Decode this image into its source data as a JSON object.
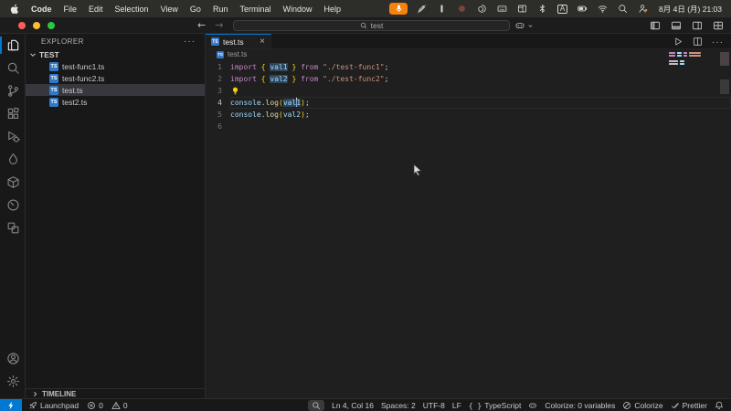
{
  "colors": {
    "accent": "#0078d4",
    "keyword": "#c586c0",
    "variable": "#9cdcfe",
    "string": "#ce9178",
    "function": "#dcdcaa",
    "bracket": "#ffd700",
    "mic_badge": "#f4820c",
    "ts_badge": "#3178c6"
  },
  "menubar": {
    "app_items": [
      "Code",
      "File",
      "Edit",
      "Selection",
      "View",
      "Go",
      "Run",
      "Terminal",
      "Window",
      "Help"
    ],
    "status_icons": [
      "mic-icon",
      "pencil-slash-icon",
      "capsule-icon",
      "record-dot-icon",
      "swirl-icon",
      "keyboard-icon",
      "window-tiles-icon",
      "bluetooth-icon",
      "input-source-icon",
      "battery-icon",
      "wifi-icon",
      "search-icon",
      "user-switch-icon"
    ],
    "input_source_label": "A",
    "clock": "8月 4日 (月) 21:03"
  },
  "titlebar": {
    "search_value": "test",
    "window_controls": [
      "layout-sidebar-left-icon",
      "layout-panel-icon",
      "layout-sidebar-right-icon",
      "customize-layout-icon"
    ]
  },
  "activity_bar": {
    "items": [
      {
        "name": "explorer-icon",
        "active": true
      },
      {
        "name": "search-icon",
        "active": false
      },
      {
        "name": "source-control-icon",
        "active": false
      },
      {
        "name": "extensions-icon",
        "active": false
      },
      {
        "name": "run-debug-icon",
        "active": false
      },
      {
        "name": "droplet-icon",
        "active": false
      },
      {
        "name": "cube-icon",
        "active": false
      },
      {
        "name": "clock-icon",
        "active": false
      },
      {
        "name": "layers-icon",
        "active": false
      }
    ],
    "bottom_items": [
      {
        "name": "account-icon"
      },
      {
        "name": "settings-gear-icon"
      }
    ]
  },
  "sidebar": {
    "title": "EXPLORER",
    "actions_label": "···",
    "folder": {
      "name": "TEST"
    },
    "files": [
      {
        "label": "test-func1.ts",
        "badge": "TS",
        "selected": false
      },
      {
        "label": "test-func2.ts",
        "badge": "TS",
        "selected": false
      },
      {
        "label": "test.ts",
        "badge": "TS",
        "selected": true
      },
      {
        "label": "test2.ts",
        "badge": "TS",
        "selected": false
      }
    ],
    "timeline_label": "TIMELINE"
  },
  "editor": {
    "tab": {
      "label": "test.ts",
      "badge": "TS"
    },
    "tab_actions": [
      "run-icon",
      "split-editor-icon",
      "more-actions-icon"
    ],
    "breadcrumb": {
      "file": "test.ts",
      "badge": "TS"
    },
    "code_lines": [
      {
        "num": "1",
        "tokens": [
          {
            "t": "import ",
            "c": "kw"
          },
          {
            "t": "{ ",
            "c": "b"
          },
          {
            "t": "val1",
            "c": "v",
            "hl": true
          },
          {
            "t": " }",
            "c": "b"
          },
          {
            "t": " from ",
            "c": "kw"
          },
          {
            "t": "\"./test-func1\"",
            "c": "s"
          },
          {
            "t": ";",
            "c": "p"
          }
        ]
      },
      {
        "num": "2",
        "tokens": [
          {
            "t": "import ",
            "c": "kw"
          },
          {
            "t": "{ ",
            "c": "b"
          },
          {
            "t": "val2",
            "c": "v",
            "hl": true
          },
          {
            "t": " }",
            "c": "b"
          },
          {
            "t": " from ",
            "c": "kw"
          },
          {
            "t": "\"./test-func2\"",
            "c": "s"
          },
          {
            "t": ";",
            "c": "p"
          }
        ]
      },
      {
        "num": "3",
        "lightbulb": true,
        "tokens": []
      },
      {
        "num": "4",
        "active": true,
        "tokens": [
          {
            "t": "console",
            "c": "v"
          },
          {
            "t": ".",
            "c": "p"
          },
          {
            "t": "log",
            "c": "fn"
          },
          {
            "t": "(",
            "c": "b"
          },
          {
            "t": "val",
            "c": "v",
            "hl": true
          },
          {
            "t": "1",
            "c": "v",
            "hl": true,
            "caretBefore": true
          },
          {
            "t": ")",
            "c": "b"
          },
          {
            "t": ";",
            "c": "p"
          }
        ]
      },
      {
        "num": "5",
        "tokens": [
          {
            "t": "console",
            "c": "v"
          },
          {
            "t": ".",
            "c": "p"
          },
          {
            "t": "log",
            "c": "fn"
          },
          {
            "t": "(",
            "c": "b"
          },
          {
            "t": "val2",
            "c": "v"
          },
          {
            "t": ")",
            "c": "b"
          },
          {
            "t": ";",
            "c": "p"
          }
        ]
      },
      {
        "num": "6",
        "tokens": []
      }
    ]
  },
  "status_bar": {
    "remote_icon": "remote-zap-icon",
    "left_items": [
      {
        "icon": "rocket-icon",
        "label": "Launchpad",
        "name": "launchpad-status"
      },
      {
        "icon": "error-icon",
        "label": "0",
        "name": "errors-count"
      },
      {
        "icon": "warning-icon",
        "label": "0",
        "name": "warnings-count"
      }
    ],
    "right_items": [
      {
        "icon": "zoom-icon",
        "label": "",
        "boxed": true,
        "name": "screencast-zoom"
      },
      {
        "label": "Ln 4, Col 16",
        "name": "cursor-position"
      },
      {
        "label": "Spaces: 2",
        "name": "indentation"
      },
      {
        "label": "UTF-8",
        "name": "encoding"
      },
      {
        "label": "LF",
        "name": "eol"
      },
      {
        "icon": "braces-icon",
        "label": "TypeScript",
        "name": "language-mode"
      },
      {
        "icon": "copilot-icon",
        "label": "",
        "name": "copilot-status"
      },
      {
        "label": "Colorize: 0 variables",
        "name": "colorize-variables"
      },
      {
        "icon": "slash-circle-icon",
        "label": "Colorize",
        "name": "colorize-toggle"
      },
      {
        "icon": "double-check-icon",
        "label": "Prettier",
        "name": "prettier-status"
      },
      {
        "icon": "bell-icon",
        "label": "",
        "name": "notifications-bell"
      }
    ]
  }
}
